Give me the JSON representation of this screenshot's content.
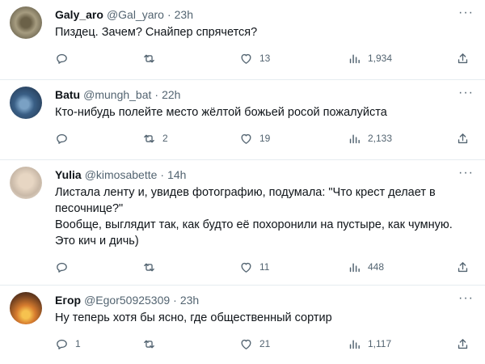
{
  "tweets": [
    {
      "name": "Galy_aro",
      "handle": "@Gal_yaro",
      "separator": "·",
      "time": "23h",
      "text": [
        "Пиздец. Зачем? Снайпер спрячется?"
      ],
      "replies": "",
      "retweets": "",
      "likes": "13",
      "views": "1,934"
    },
    {
      "name": "Batu",
      "handle": "@mungh_bat",
      "separator": "·",
      "time": "22h",
      "text": [
        "Кто-нибудь полейте место жёлтой божьей росой пожалуйста"
      ],
      "replies": "",
      "retweets": "2",
      "likes": "19",
      "views": "2,133"
    },
    {
      "name": "Yulia",
      "handle": "@kimosabette",
      "separator": "·",
      "time": "14h",
      "text": [
        "Листала ленту и, увидев фотографию, подумала: \"Что крест делает в песочнице?\"",
        "Вообще, выглядит так, как будто её похоронили на пустыре, как чумную. Это кич и дичь)"
      ],
      "replies": "",
      "retweets": "",
      "likes": "11",
      "views": "448"
    },
    {
      "name": "Егор",
      "handle": "@Egor50925309",
      "separator": "·",
      "time": "23h",
      "text": [
        "Ну теперь хотя бы ясно, где общественный сортир"
      ],
      "replies": "1",
      "retweets": "",
      "likes": "21",
      "views": "1,117"
    }
  ],
  "ui": {
    "more_glyph": "···",
    "icons": [
      "reply-icon",
      "retweet-icon",
      "like-icon",
      "views-icon",
      "share-icon"
    ],
    "colors": {
      "text": "#0f1419",
      "secondary": "#536471",
      "divider": "#e6ecf0"
    }
  }
}
